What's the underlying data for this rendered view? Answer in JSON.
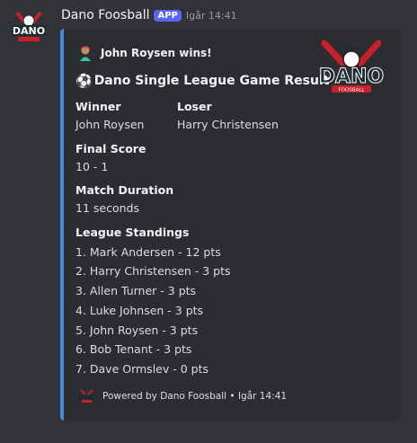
{
  "message": {
    "username": "Dano Foosball",
    "badge": "APP",
    "timestamp": "Igår 14:41"
  },
  "embed": {
    "accent_color": "#3b8fd6",
    "author": "John Roysen wins!",
    "title": "Dano Single League Game Result",
    "winner": {
      "name": "Winner",
      "value": "John Roysen"
    },
    "loser": {
      "name": "Loser",
      "value": "Harry Christensen"
    },
    "score": {
      "name": "Final Score",
      "value": "10 - 1"
    },
    "duration": {
      "name": "Match Duration",
      "value": "11 seconds"
    },
    "standings": {
      "name": "League Standings",
      "items": [
        "1. Mark Andersen - 12 pts",
        "2. Harry Christensen - 3 pts",
        "3. Allen Turner - 3 pts",
        "4. Luke Johnsen - 3 pts",
        "5. John Roysen - 3 pts",
        "6. Bob Tenant - 3 pts",
        "7. Dave Ormslev - 0 pts"
      ]
    },
    "footer": {
      "text": "Powered by Dano Foosball",
      "separator": "•",
      "timestamp": "Igår 14:41"
    },
    "logo_text": "DANO FOOSBALL"
  }
}
